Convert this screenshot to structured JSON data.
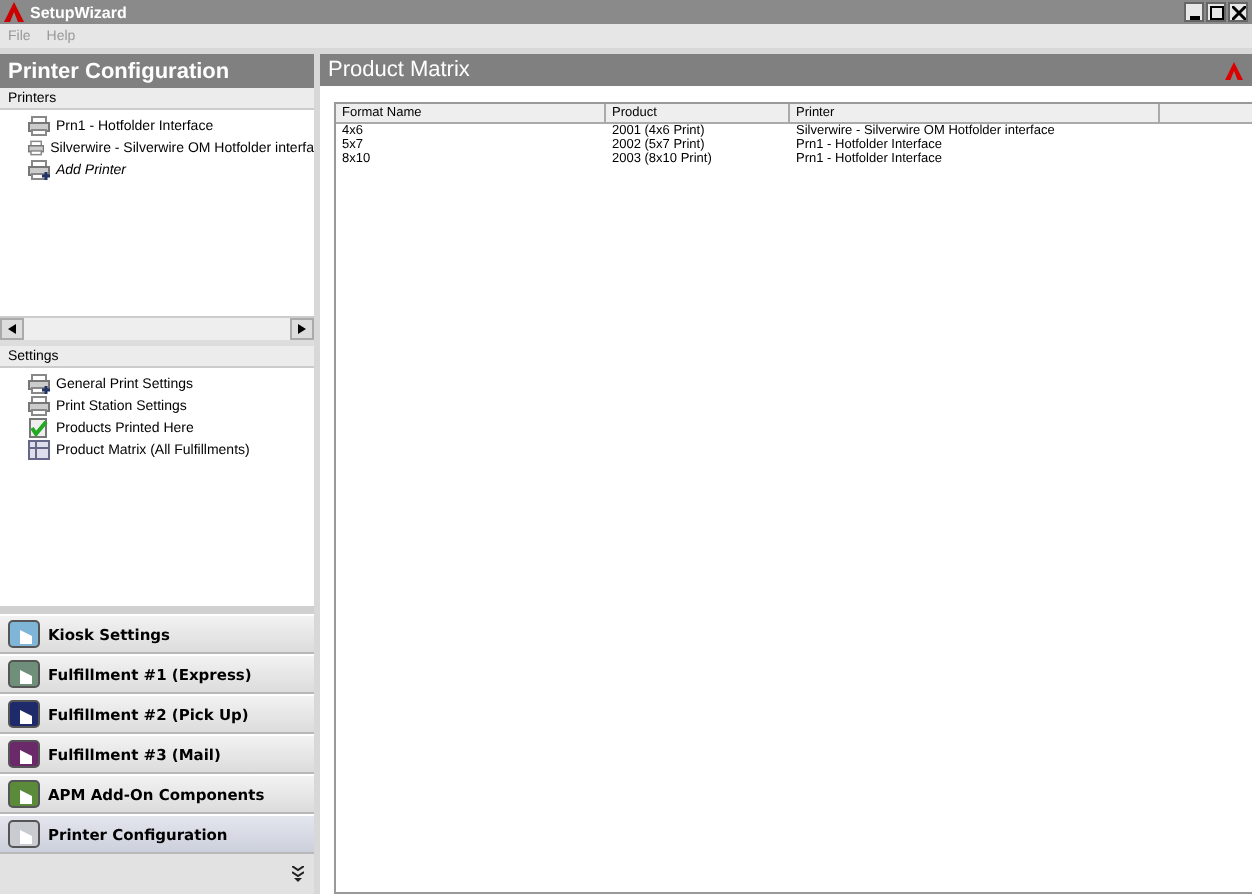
{
  "window": {
    "title": "SetupWizard"
  },
  "menu": [
    "File",
    "Help"
  ],
  "sidebar": {
    "title": "Printer Configuration",
    "printers": {
      "header": "Printers",
      "items": [
        {
          "label": "Prn1 - Hotfolder Interface",
          "kind": "printer"
        },
        {
          "label": "Silverwire - Silverwire OM Hotfolder interfa",
          "kind": "printer"
        },
        {
          "label": "Add Printer",
          "kind": "add"
        }
      ]
    },
    "settings": {
      "header": "Settings",
      "items": [
        {
          "label": "General Print Settings",
          "kind": "general"
        },
        {
          "label": "Print Station Settings",
          "kind": "printer"
        },
        {
          "label": "Products Printed Here",
          "kind": "products"
        },
        {
          "label": "Product Matrix (All Fulfillments)",
          "kind": "matrix"
        }
      ]
    },
    "nav": [
      {
        "label": "Kiosk Settings",
        "kind": "kiosk",
        "selected": false
      },
      {
        "label": "Fulfillment #1 (Express)",
        "kind": "f1",
        "selected": false
      },
      {
        "label": "Fulfillment #2 (Pick Up)",
        "kind": "f2",
        "selected": false
      },
      {
        "label": "Fulfillment #3 (Mail)",
        "kind": "f3",
        "selected": false
      },
      {
        "label": "APM Add-On Components",
        "kind": "apm",
        "selected": false
      },
      {
        "label": "Printer Configuration",
        "kind": "printer",
        "selected": true
      }
    ]
  },
  "main": {
    "title": "Product Matrix",
    "table": {
      "columns": [
        "Format Name",
        "Product",
        "Printer"
      ],
      "rows": [
        [
          "4x6",
          "2001 (4x6 Print)",
          "Silverwire - Silverwire OM Hotfolder interface"
        ],
        [
          "5x7",
          "2002 (5x7 Print)",
          "Prn1 - Hotfolder Interface"
        ],
        [
          "8x10",
          "2003 (8x10 Print)",
          "Prn1 - Hotfolder Interface"
        ]
      ]
    }
  }
}
